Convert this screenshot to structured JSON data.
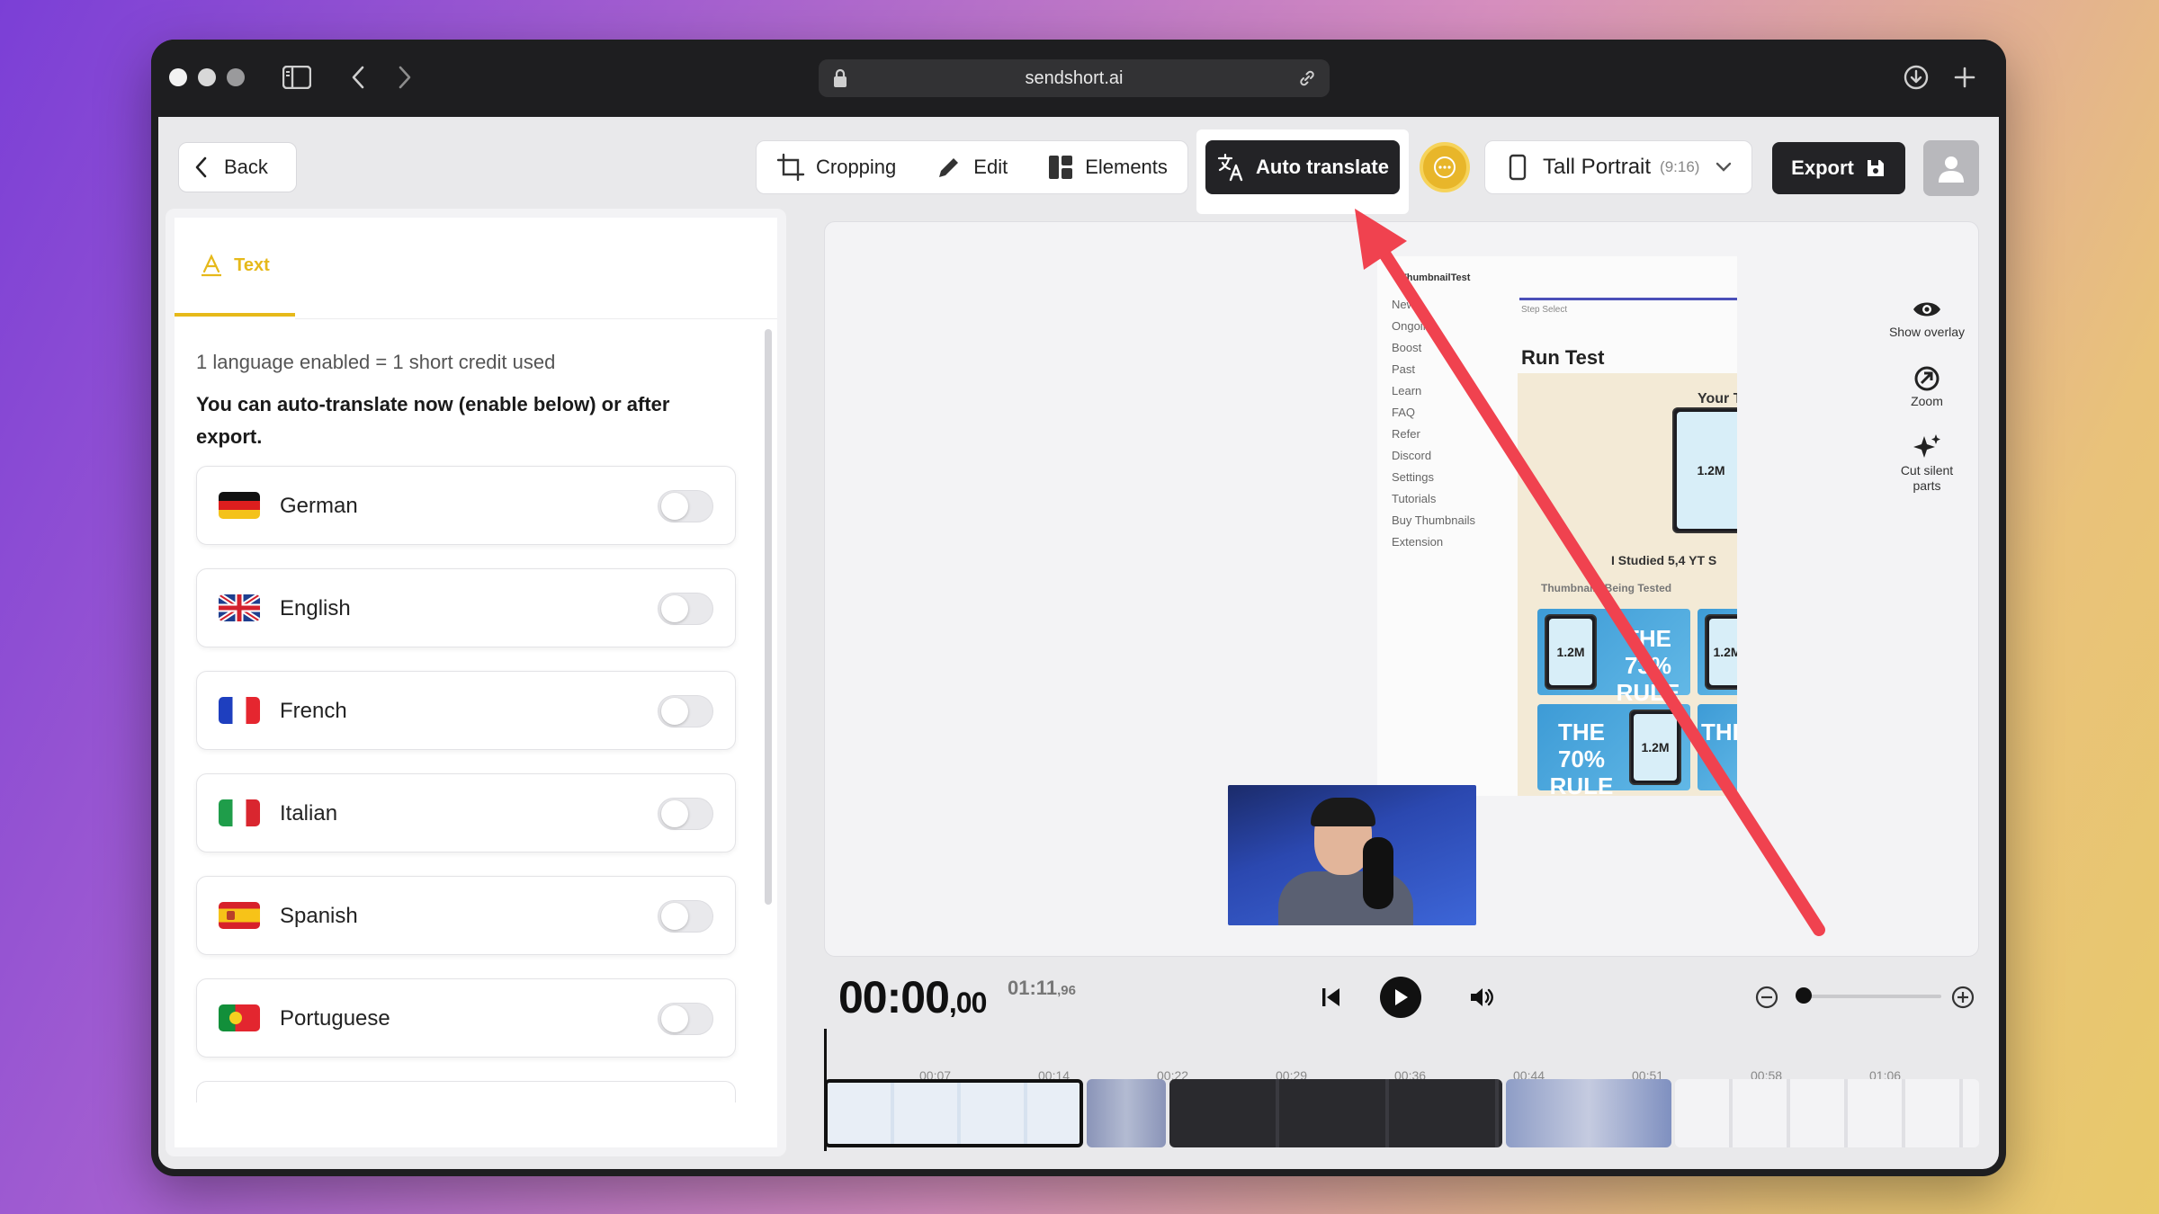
{
  "browser": {
    "url": "sendshort.ai"
  },
  "toolbar": {
    "back_label": "Back",
    "tools": [
      {
        "label": "Cropping",
        "icon": "crop-icon"
      },
      {
        "label": "Edit",
        "icon": "pencil-icon"
      },
      {
        "label": "Elements",
        "icon": "layout-icon"
      }
    ],
    "auto_translate_label": "Auto translate",
    "format_label": "Tall Portrait",
    "format_ratio": "(9:16)",
    "export_label": "Export"
  },
  "panel": {
    "tab_label": "Text",
    "credit_note": "1 language enabled = 1 short credit used",
    "info": "You can auto-translate now (enable below) or after export.",
    "languages": [
      {
        "name": "German",
        "flag": "de",
        "enabled": false
      },
      {
        "name": "English",
        "flag": "gb",
        "enabled": false
      },
      {
        "name": "French",
        "flag": "fr",
        "enabled": false
      },
      {
        "name": "Italian",
        "flag": "it",
        "enabled": false
      },
      {
        "name": "Spanish",
        "flag": "es",
        "enabled": false
      },
      {
        "name": "Portuguese",
        "flag": "pt",
        "enabled": false
      }
    ]
  },
  "preview": {
    "side_tools": [
      {
        "label": "Show overlay",
        "icon": "eye-icon"
      },
      {
        "label": "Zoom",
        "icon": "zoom-icon"
      },
      {
        "label": "Cut silent parts",
        "icon": "sparkle-icon"
      }
    ],
    "video": {
      "logo": "ThumbnailTest",
      "nav": [
        "New",
        "Ongoing",
        "Boost",
        "Past",
        "Learn",
        "FAQ",
        "Refer",
        "Discord",
        "Settings",
        "Tutorials",
        "Buy Thumbnails",
        "Extension"
      ],
      "steps": "Step\nSelect",
      "heading": "Run Test",
      "your_t": "Your T",
      "studied": "I Studied 5,4",
      "studied_tail": "YT S",
      "thumbs_header": "Thumbnails Being Tested",
      "thumb_1": "THE 73% RULE",
      "thumb_2": "THE 70% RULE",
      "thumb_3": "THE RU",
      "views": "1.2M"
    }
  },
  "player": {
    "time_main": "00:00",
    "time_frac": ",00",
    "duration_main": "01:11",
    "duration_frac": ",96"
  },
  "timeline": {
    "ticks": [
      "00:07",
      "00:14",
      "00:22",
      "00:29",
      "00:36",
      "00:44",
      "00:51",
      "00:58",
      "01:06"
    ]
  },
  "colors": {
    "accent": "#e6b91a",
    "dark": "#232326",
    "annotation_arrow": "#f0424f"
  }
}
